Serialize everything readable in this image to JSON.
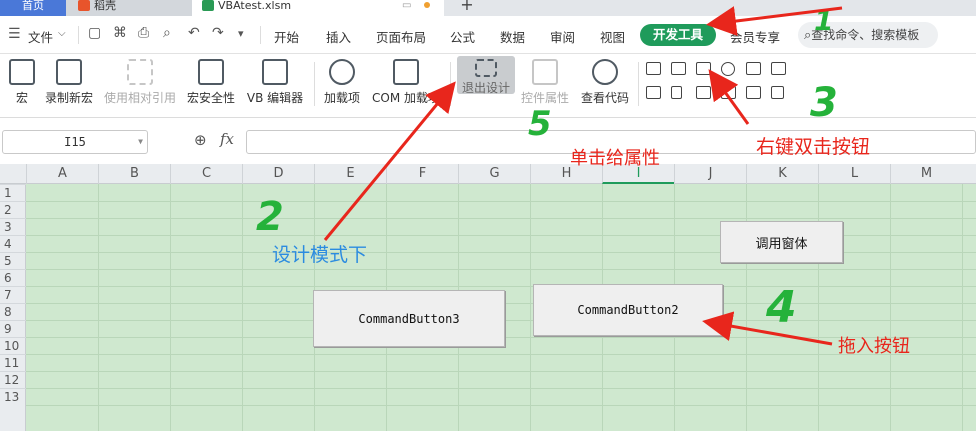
{
  "tabs": {
    "home": "首页",
    "doc": "稻壳",
    "file": "VBAtest.xlsm",
    "add": "+"
  },
  "menu": {
    "file": "文件",
    "items": [
      "开始",
      "插入",
      "页面布局",
      "公式",
      "数据",
      "审阅",
      "视图"
    ],
    "active": "开发工具",
    "member": "会员专享",
    "search_placeholder": "查找命令、搜索模板"
  },
  "ribbon": {
    "macro": "宏",
    "record": "录制新宏",
    "relative": "使用相对引用",
    "security": "宏安全性",
    "vbe": "VB 编辑器",
    "addins": "加载项",
    "com_addins": "COM 加载项",
    "exit_design": "退出设计",
    "control_props": "控件属性",
    "view_code": "查看代码"
  },
  "formula": {
    "cell_ref": "I15",
    "fx": "fx",
    "value": ""
  },
  "grid": {
    "columns": [
      "A",
      "B",
      "C",
      "D",
      "E",
      "F",
      "G",
      "H",
      "I",
      "J",
      "K",
      "L",
      "M"
    ],
    "selected_column": "I",
    "rows": [
      "1",
      "2",
      "3",
      "4",
      "5",
      "6",
      "7",
      "8",
      "9",
      "10",
      "11",
      "12",
      "13"
    ]
  },
  "buttons": {
    "call_window": "调用窗体",
    "cmd2": "CommandButton2",
    "cmd3": "CommandButton3"
  },
  "annotations": {
    "right_double_click": "右键双击按钮",
    "single_click_props": "单击给属性",
    "design_mode": "设计模式下",
    "drag_button": "拖入按钮",
    "n1": "1",
    "n2": "2",
    "n3": "3",
    "n4": "4",
    "n5": "5"
  },
  "colors": {
    "accent": "#1f9b5b",
    "annotation_red": "#e8261c",
    "annotation_blue": "#2b8be0",
    "annotation_green": "#25b23a",
    "sheet_bg": "#cfe8cf"
  }
}
